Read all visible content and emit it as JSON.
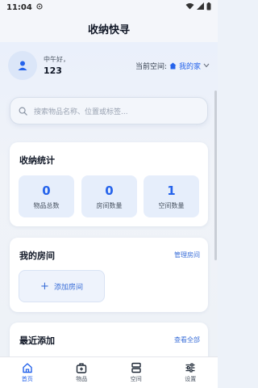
{
  "status_bar": {
    "time": "11:04"
  },
  "header": {
    "title": "收纳快寻"
  },
  "user": {
    "greeting": "中午好，",
    "name": "123"
  },
  "space_selector": {
    "label": "当前空间:",
    "value": "我的家"
  },
  "search": {
    "placeholder": "搜索物品名称、位置或标签..."
  },
  "stats": {
    "title": "收纳统计",
    "items": [
      {
        "value": "0",
        "label": "物品总数"
      },
      {
        "value": "0",
        "label": "房间数量"
      },
      {
        "value": "1",
        "label": "空间数量"
      }
    ]
  },
  "rooms": {
    "title": "我的房间",
    "manage_label": "管理房间",
    "add_label": "添加房间"
  },
  "recent": {
    "title": "最近添加",
    "view_all_label": "查看全部"
  },
  "nav": {
    "items": [
      {
        "label": "首页",
        "icon": "home-icon",
        "active": true
      },
      {
        "label": "物品",
        "icon": "box-icon",
        "active": false
      },
      {
        "label": "空间",
        "icon": "space-icon",
        "active": false
      },
      {
        "label": "设置",
        "icon": "settings-icon",
        "active": false
      }
    ]
  },
  "colors": {
    "accent": "#2563eb",
    "background": "#edf2f9"
  }
}
